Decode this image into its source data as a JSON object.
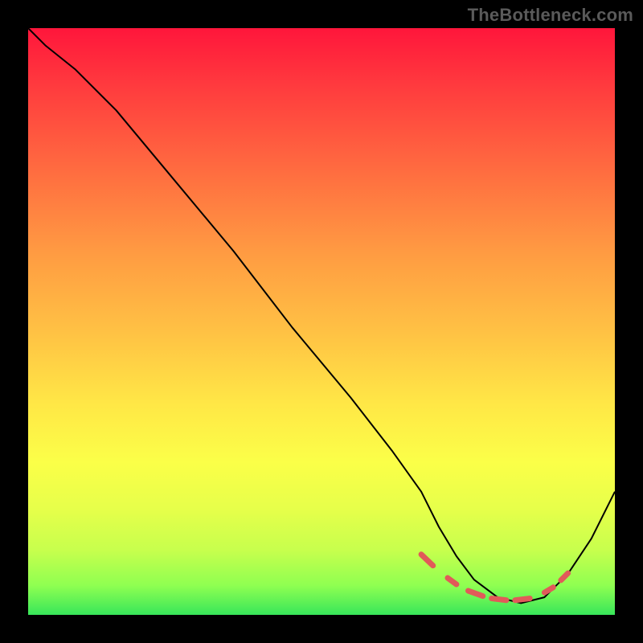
{
  "watermark": "TheBottleneck.com",
  "chart_data": {
    "type": "line",
    "title": "",
    "xlabel": "",
    "ylabel": "",
    "xlim": [
      0,
      100
    ],
    "ylim": [
      0,
      100
    ],
    "grid": false,
    "series": [
      {
        "name": "curve",
        "x": [
          0,
          3,
          8,
          15,
          25,
          35,
          45,
          55,
          62,
          67,
          70,
          73,
          76,
          80,
          84,
          88,
          92,
          96,
          100
        ],
        "y": [
          100,
          97,
          93,
          86,
          74,
          62,
          49,
          37,
          28,
          21,
          15,
          10,
          6,
          3,
          2,
          3,
          7,
          13,
          21
        ]
      }
    ],
    "markers": {
      "name": "dashes",
      "segments": [
        {
          "x1": 67.0,
          "y1": 10.3,
          "x2": 69.0,
          "y2": 8.4
        },
        {
          "x1": 71.5,
          "y1": 6.3,
          "x2": 73.0,
          "y2": 5.2
        },
        {
          "x1": 75.0,
          "y1": 4.1,
          "x2": 77.5,
          "y2": 3.2
        },
        {
          "x1": 79.0,
          "y1": 2.8,
          "x2": 81.5,
          "y2": 2.5
        },
        {
          "x1": 83.0,
          "y1": 2.5,
          "x2": 85.5,
          "y2": 2.8
        },
        {
          "x1": 88.0,
          "y1": 3.8,
          "x2": 89.5,
          "y2": 4.7
        },
        {
          "x1": 90.8,
          "y1": 5.9,
          "x2": 92.0,
          "y2": 7.1
        }
      ]
    }
  }
}
